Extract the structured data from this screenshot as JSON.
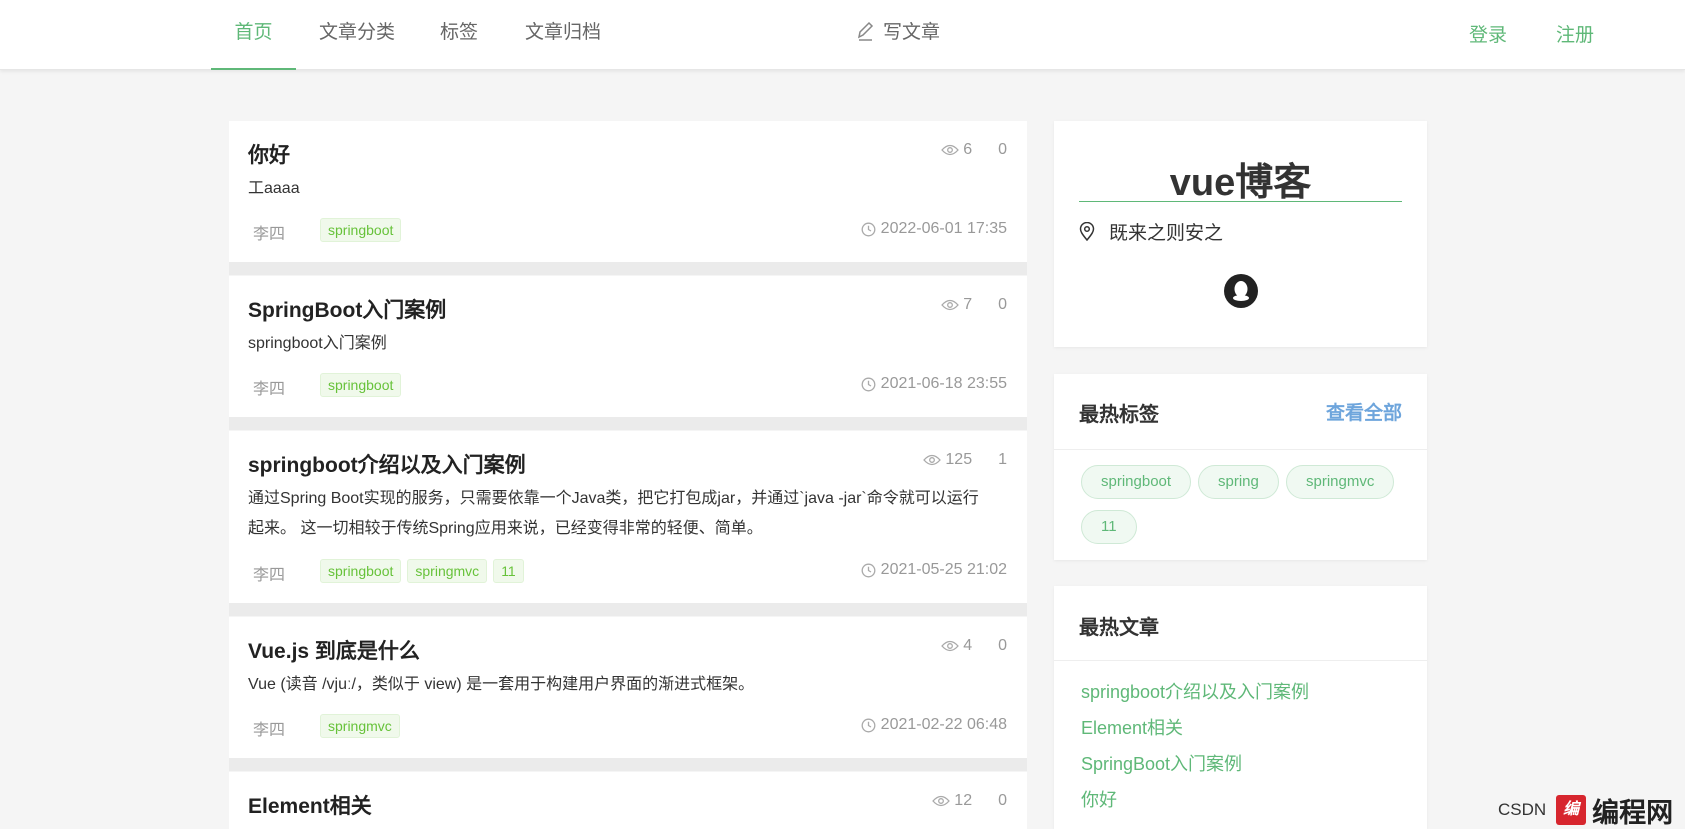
{
  "nav": {
    "items": [
      {
        "label": "首页",
        "active": true
      },
      {
        "label": "文章分类",
        "active": false
      },
      {
        "label": "标签",
        "active": false
      },
      {
        "label": "文章归档",
        "active": false
      }
    ],
    "write": "写文章",
    "login": "登录",
    "register": "注册"
  },
  "articles": [
    {
      "title": "你好",
      "views": "6",
      "comments": "0",
      "summary": "工aaaa",
      "author": "李四",
      "tags": [
        "springboot"
      ],
      "date": "2022-06-01 17:35"
    },
    {
      "title": "SpringBoot入门案例",
      "views": "7",
      "comments": "0",
      "summary": "springboot入门案例",
      "author": "李四",
      "tags": [
        "springboot"
      ],
      "date": "2021-06-18 23:55"
    },
    {
      "title": "springboot介绍以及入门案例",
      "views": "125",
      "comments": "1",
      "summary_lines": [
        "通过Spring Boot实现的服务，只需要依靠一个Java类，把它打包成jar，并通过`java -jar`命令就可以运行",
        "起来。 这一切相较于传统Spring应用来说，已经变得非常的轻便、简单。"
      ],
      "author": "李四",
      "tags": [
        "springboot",
        "springmvc",
        "11"
      ],
      "date": "2021-05-25 21:02"
    },
    {
      "title": "Vue.js 到底是什么",
      "views": "4",
      "comments": "0",
      "summary": "Vue (读音 /vjuː/，类似于 view) 是一套用于构建用户界面的渐进式框架。",
      "author": "李四",
      "tags": [
        "springmvc"
      ],
      "date": "2021-02-22 06:48"
    },
    {
      "title": "Element相关",
      "views": "12",
      "comments": "0"
    }
  ],
  "profile": {
    "blog_name": "vue博客",
    "motto": "既来之则安之"
  },
  "hot_tags": {
    "title": "最热标签",
    "more": "查看全部",
    "tags": [
      "springboot",
      "spring",
      "springmvc",
      "11"
    ]
  },
  "hot_articles": {
    "title": "最热文章",
    "items": [
      "springboot介绍以及入门案例",
      "Element相关",
      "SpringBoot入门案例",
      "你好"
    ]
  },
  "watermark": {
    "csdn": "CSDN",
    "logo": "编",
    "site": "编程网"
  },
  "colors": {
    "accent": "#5fb878",
    "link_blue": "#6ea5dc",
    "tag_green": "#67c23a"
  }
}
